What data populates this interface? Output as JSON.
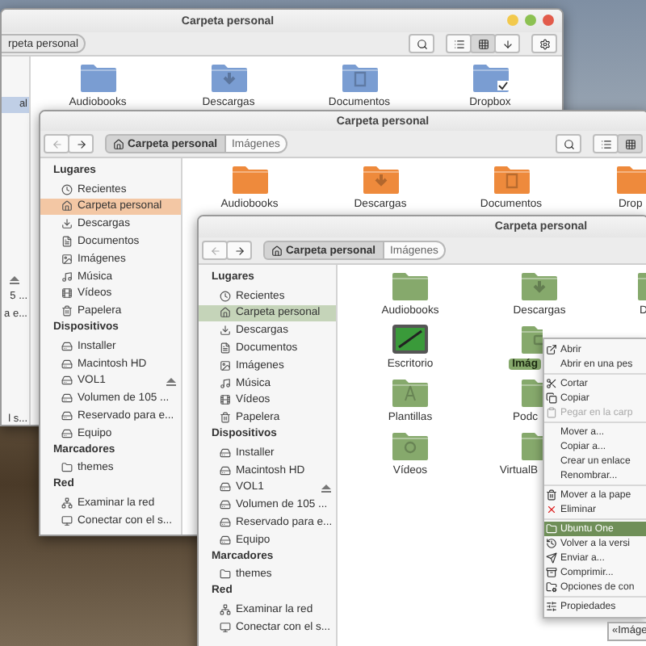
{
  "windows": [
    {
      "title": "Carpeta personal",
      "color": "#7a9dd2",
      "path": [
        {
          "label": "rpeta personal",
          "selected": true
        }
      ],
      "view_modes": [
        {
          "selected": false
        },
        {
          "selected": true
        },
        {
          "selected": false
        }
      ],
      "sidebar_fragments": [
        {
          "label": "al",
          "selected": true
        },
        {
          "label": "5 ...",
          "selected": false
        },
        {
          "label": "a e...",
          "selected": false
        },
        {
          "label": "l s...",
          "selected": false
        }
      ],
      "file_rows": [
        [
          {
            "label": "Audiobooks",
            "kind": "folder",
            "selected": false
          },
          {
            "label": "Descargas",
            "kind": "downloads",
            "selected": false
          },
          {
            "label": "Documentos",
            "kind": "documents",
            "selected": false
          },
          {
            "label": "Dropbox",
            "kind": "synced",
            "selected": false
          }
        ]
      ]
    },
    {
      "title": "Carpeta personal",
      "color": "#ee8a3c",
      "back": {
        "disabled": true
      },
      "forward": {
        "disabled": false
      },
      "path": [
        {
          "label": "Carpeta personal",
          "selected": true
        },
        {
          "label": "Imágenes",
          "selected": false
        }
      ],
      "view_modes": [
        {
          "selected": false
        },
        {
          "selected": true
        }
      ],
      "sidebar": [
        {
          "heading": "Lugares",
          "items": [
            {
              "label": "Recientes",
              "selected": false
            },
            {
              "label": "Carpeta personal",
              "selected": true
            },
            {
              "label": "Descargas",
              "selected": false
            },
            {
              "label": "Documentos",
              "selected": false
            },
            {
              "label": "Imágenes",
              "selected": false
            },
            {
              "label": "Música",
              "selected": false
            },
            {
              "label": "Vídeos",
              "selected": false
            },
            {
              "label": "Papelera",
              "selected": false
            }
          ]
        },
        {
          "heading": "Dispositivos",
          "items": [
            {
              "label": "Installer",
              "selected": false
            },
            {
              "label": "Macintosh HD",
              "selected": false
            },
            {
              "label": "VOL1",
              "selected": false
            },
            {
              "label": "Volumen de 105 ...",
              "selected": false
            },
            {
              "label": "Reservado para e...",
              "selected": false
            },
            {
              "label": "Equipo",
              "selected": false
            }
          ]
        },
        {
          "heading": "Marcadores",
          "items": [
            {
              "label": "themes",
              "selected": false
            }
          ]
        },
        {
          "heading": "Red",
          "items": [
            {
              "label": "Examinar la red",
              "selected": false
            },
            {
              "label": "Conectar con el s...",
              "selected": false
            }
          ]
        }
      ],
      "file_rows": [
        [
          {
            "label": "Audiobooks",
            "kind": "folder",
            "selected": false
          },
          {
            "label": "Descargas",
            "kind": "downloads",
            "selected": false
          },
          {
            "label": "Documentos",
            "kind": "documents",
            "selected": false
          },
          {
            "label": "Drop",
            "kind": "folder",
            "selected": false
          }
        ]
      ]
    },
    {
      "title": "Carpeta personal",
      "color": "#86a96c",
      "back": {
        "disabled": true
      },
      "forward": {
        "disabled": false
      },
      "path": [
        {
          "label": "Carpeta personal",
          "selected": true
        },
        {
          "label": "Imágenes",
          "selected": false
        }
      ],
      "sidebar": [
        {
          "heading": "Lugares",
          "items": [
            {
              "label": "Recientes",
              "selected": false
            },
            {
              "label": "Carpeta personal",
              "selected": true
            },
            {
              "label": "Descargas",
              "selected": false
            },
            {
              "label": "Documentos",
              "selected": false
            },
            {
              "label": "Imágenes",
              "selected": false
            },
            {
              "label": "Música",
              "selected": false
            },
            {
              "label": "Vídeos",
              "selected": false
            },
            {
              "label": "Papelera",
              "selected": false
            }
          ]
        },
        {
          "heading": "Dispositivos",
          "items": [
            {
              "label": "Installer",
              "selected": false
            },
            {
              "label": "Macintosh HD",
              "selected": false
            },
            {
              "label": "VOL1",
              "selected": false
            },
            {
              "label": "Volumen de 105 ...",
              "selected": false
            },
            {
              "label": "Reservado para e...",
              "selected": false
            },
            {
              "label": "Equipo",
              "selected": false
            }
          ]
        },
        {
          "heading": "Marcadores",
          "items": [
            {
              "label": "themes",
              "selected": false
            }
          ]
        },
        {
          "heading": "Red",
          "items": [
            {
              "label": "Examinar la red",
              "selected": false
            },
            {
              "label": "Conectar con el s...",
              "selected": false
            }
          ]
        }
      ],
      "file_rows": [
        [
          {
            "label": "Audiobooks",
            "kind": "folder",
            "selected": false
          },
          {
            "label": "Descargas",
            "kind": "downloads",
            "selected": false
          },
          {
            "label": "D",
            "kind": "documents",
            "selected": false
          }
        ],
        [
          {
            "label": "Escritorio",
            "kind": "desktop",
            "selected": false
          },
          {
            "label": "Imág",
            "kind": "pictures",
            "selected": true
          }
        ],
        [
          {
            "label": "Plantillas",
            "kind": "templates",
            "selected": false
          },
          {
            "label": "Podc",
            "kind": "folder",
            "selected": false
          }
        ],
        [
          {
            "label": "Vídeos",
            "kind": "videos",
            "selected": false
          },
          {
            "label": "VirtualB",
            "kind": "folder",
            "selected": false
          }
        ]
      ]
    }
  ],
  "context_menu": {
    "items": [
      {
        "kind": "item",
        "label": "Abrir",
        "selected": false,
        "disabled": false
      },
      {
        "kind": "item",
        "label": "Abrir en una pes",
        "selected": false,
        "disabled": false
      },
      {
        "kind": "separator"
      },
      {
        "kind": "item",
        "label": "Cortar",
        "selected": false,
        "disabled": false
      },
      {
        "kind": "item",
        "label": "Copiar",
        "selected": false,
        "disabled": false
      },
      {
        "kind": "item",
        "label": "Pegar en la carp",
        "selected": false,
        "disabled": true
      },
      {
        "kind": "separator"
      },
      {
        "kind": "item",
        "label": "Mover a...",
        "selected": false,
        "disabled": false
      },
      {
        "kind": "item",
        "label": "Copiar a...",
        "selected": false,
        "disabled": false
      },
      {
        "kind": "item",
        "label": "Crear un enlace",
        "selected": false,
        "disabled": false
      },
      {
        "kind": "item",
        "label": "Renombrar...",
        "selected": false,
        "disabled": false
      },
      {
        "kind": "separator"
      },
      {
        "kind": "item",
        "label": "Mover a la pape",
        "selected": false,
        "disabled": false
      },
      {
        "kind": "item",
        "label": "Eliminar",
        "selected": false,
        "disabled": false
      },
      {
        "kind": "separator"
      },
      {
        "kind": "item",
        "label": "Ubuntu One",
        "selected": true,
        "disabled": false
      },
      {
        "kind": "item",
        "label": "Volver a la versi",
        "selected": false,
        "disabled": false
      },
      {
        "kind": "item",
        "label": "Enviar a...",
        "selected": false,
        "disabled": false
      },
      {
        "kind": "item",
        "label": "Comprimir...",
        "selected": false,
        "disabled": false
      },
      {
        "kind": "item",
        "label": "Opciones de con",
        "selected": false,
        "disabled": false
      },
      {
        "kind": "separator"
      },
      {
        "kind": "item",
        "label": "Propiedades",
        "selected": false,
        "disabled": false
      }
    ]
  },
  "status_tooltip": "«Imáge"
}
